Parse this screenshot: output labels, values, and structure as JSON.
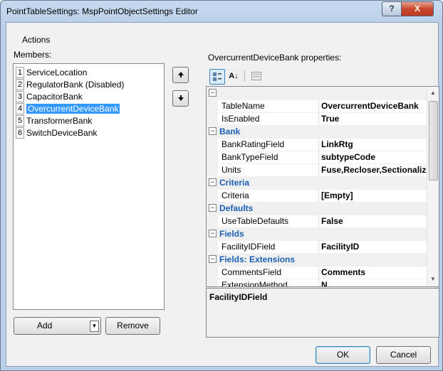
{
  "window": {
    "title": "PointTableSettings: MspPointObjectSettings Editor",
    "help_label": "?",
    "close_label": "X"
  },
  "actions_label": "Actions",
  "members": {
    "label": "Members:",
    "items": [
      {
        "num": "1",
        "label": "ServiceLocation",
        "selected": false
      },
      {
        "num": "2",
        "label": "RegulatorBank (Disabled)",
        "selected": false
      },
      {
        "num": "3",
        "label": "CapacitorBank",
        "selected": false
      },
      {
        "num": "4",
        "label": "OvercurrentDeviceBank",
        "selected": true
      },
      {
        "num": "5",
        "label": "TransformerBank",
        "selected": false
      },
      {
        "num": "6",
        "label": "SwitchDeviceBank",
        "selected": false
      }
    ],
    "move_up_icon": "arrow-up-icon",
    "move_down_icon": "arrow-down-icon"
  },
  "properties": {
    "label": "OvercurrentDeviceBank properties:",
    "rows": [
      {
        "kind": "category",
        "name": "",
        "toggle": "⊟"
      },
      {
        "kind": "prop",
        "name": "TableName",
        "value": "OvercurrentDeviceBank"
      },
      {
        "kind": "prop",
        "name": "IsEnabled",
        "value": "True"
      },
      {
        "kind": "category",
        "name": "Bank",
        "toggle": "⊟"
      },
      {
        "kind": "prop",
        "name": "BankRatingField",
        "value": "LinkRtg"
      },
      {
        "kind": "prop",
        "name": "BankTypeField",
        "value": "subtypeCode"
      },
      {
        "kind": "prop",
        "name": "Units",
        "value": "Fuse,Recloser,Sectionalizer"
      },
      {
        "kind": "category",
        "name": "Criteria",
        "toggle": "⊟"
      },
      {
        "kind": "prop",
        "name": "Criteria",
        "value": "[Empty]"
      },
      {
        "kind": "category",
        "name": "Defaults",
        "toggle": "⊟"
      },
      {
        "kind": "prop",
        "name": "UseTableDefaults",
        "value": "False"
      },
      {
        "kind": "category",
        "name": "Fields",
        "toggle": "⊟"
      },
      {
        "kind": "prop",
        "name": "FacilityIDField",
        "value": "FacilityID"
      },
      {
        "kind": "category",
        "name": "Fields: Extensions",
        "toggle": "⊟"
      },
      {
        "kind": "prop",
        "name": "CommentsField",
        "value": "Comments"
      },
      {
        "kind": "prop",
        "name": "ExtensionMethod",
        "value": "N"
      }
    ],
    "description_title": "FacilityIDField"
  },
  "buttons": {
    "add": "Add",
    "remove": "Remove",
    "ok": "OK",
    "cancel": "Cancel"
  },
  "colors": {
    "selection": "#3399ff",
    "category_text": "#1a5fb4"
  }
}
